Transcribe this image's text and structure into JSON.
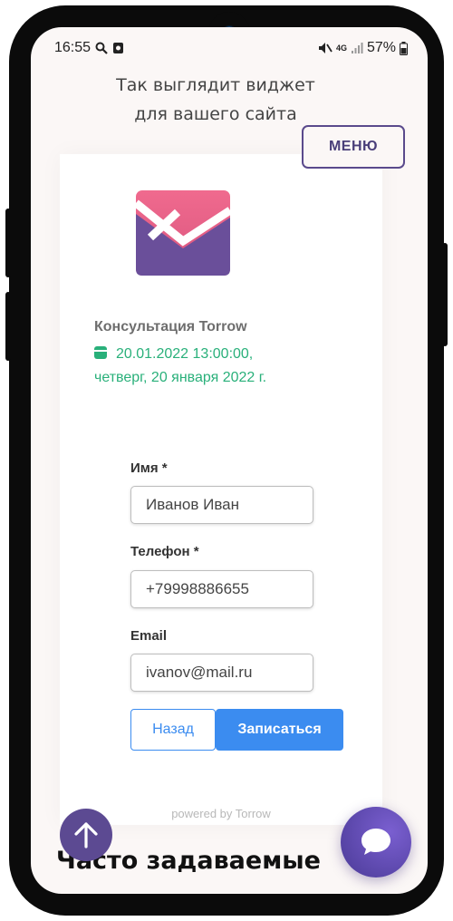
{
  "status": {
    "time": "16:55",
    "battery": "57%",
    "network": "4G"
  },
  "header": {
    "line1": "Так выглядит виджет",
    "line2": "для вашего сайта",
    "menu_label": "МЕНЮ"
  },
  "widget": {
    "title": "Консультация Torrow",
    "date_line1": "20.01.2022 13:00:00,",
    "date_line2": "четверг, 20 января 2022 г.",
    "form": {
      "name_label": "Имя *",
      "name_value": "Иванов Иван",
      "phone_label": "Телефон *",
      "phone_value": "+79998886655",
      "email_label": "Email",
      "email_value": "ivanov@mail.ru"
    },
    "back_label": "Назад",
    "submit_label": "Записаться",
    "powered_by": "powered by Torrow"
  },
  "faq": {
    "title": "Часто задаваемые"
  },
  "colors": {
    "accent": "#3b8cf0",
    "green": "#29b07a",
    "purple": "#5c4a92",
    "logo_pink": "#e8608a"
  }
}
